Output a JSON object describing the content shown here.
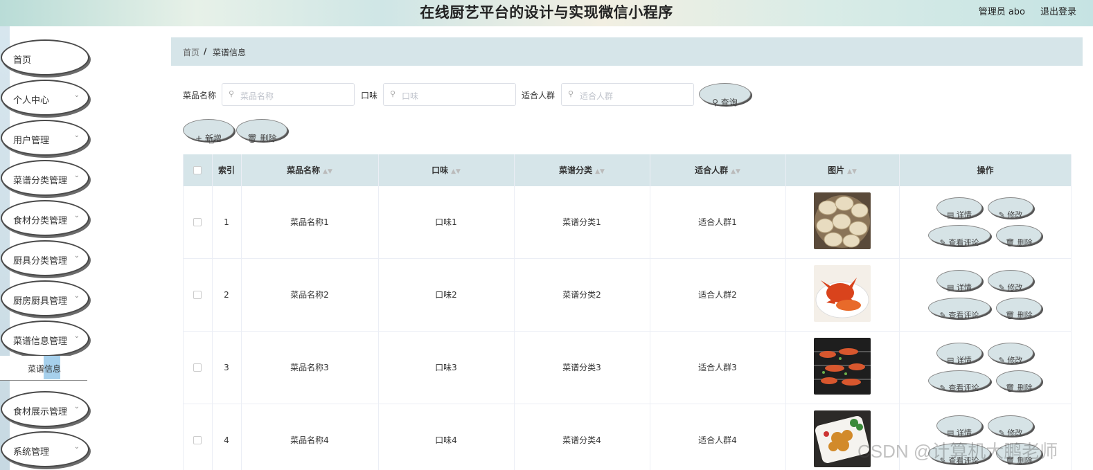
{
  "header": {
    "title": "在线厨艺平台的设计与实现微信小程序",
    "user": "管理员 abo",
    "logout": "退出登录"
  },
  "sidebar": {
    "items": [
      {
        "label": "首页",
        "arrow": false
      },
      {
        "label": "个人中心",
        "arrow": true
      },
      {
        "label": "用户管理",
        "arrow": true
      },
      {
        "label": "菜谱分类管理",
        "arrow": true
      },
      {
        "label": "食材分类管理",
        "arrow": true
      },
      {
        "label": "厨具分类管理",
        "arrow": true
      },
      {
        "label": "厨房厨具管理",
        "arrow": true
      },
      {
        "label": "菜谱信息管理",
        "arrow": true
      },
      {
        "label": "食材展示管理",
        "arrow": true
      },
      {
        "label": "系统管理",
        "arrow": true
      }
    ],
    "submenu": "菜谱信息"
  },
  "breadcrumb": {
    "home": "首页",
    "sep": "/",
    "current": "菜谱信息"
  },
  "search": {
    "name_label": "菜品名称",
    "name_placeholder": "菜品名称",
    "taste_label": "口味",
    "taste_placeholder": "口味",
    "crowd_label": "适合人群",
    "crowd_placeholder": "适合人群",
    "query": "查询"
  },
  "actions": {
    "add": "新增",
    "delete": "删除"
  },
  "table": {
    "headers": [
      "索引",
      "菜品名称",
      "口味",
      "菜谱分类",
      "适合人群",
      "图片",
      "操作"
    ],
    "rows": [
      {
        "index": "1",
        "name": "菜品名称1",
        "taste": "口味1",
        "category": "菜谱分类1",
        "crowd": "适合人群1",
        "image": "dumplings"
      },
      {
        "index": "2",
        "name": "菜品名称2",
        "taste": "口味2",
        "category": "菜谱分类2",
        "crowd": "适合人群2",
        "image": "crab"
      },
      {
        "index": "3",
        "name": "菜品名称3",
        "taste": "口味3",
        "category": "菜谱分类3",
        "crowd": "适合人群3",
        "image": "grilled-shrimp"
      },
      {
        "index": "4",
        "name": "菜品名称4",
        "taste": "口味4",
        "category": "菜谱分类4",
        "crowd": "适合人群4",
        "image": "fried-dish"
      }
    ],
    "ops": {
      "detail": "详情",
      "edit": "修改",
      "comments": "查看评论",
      "delete": "删除"
    }
  },
  "watermark": "CSDN @计算机大鹏老师"
}
